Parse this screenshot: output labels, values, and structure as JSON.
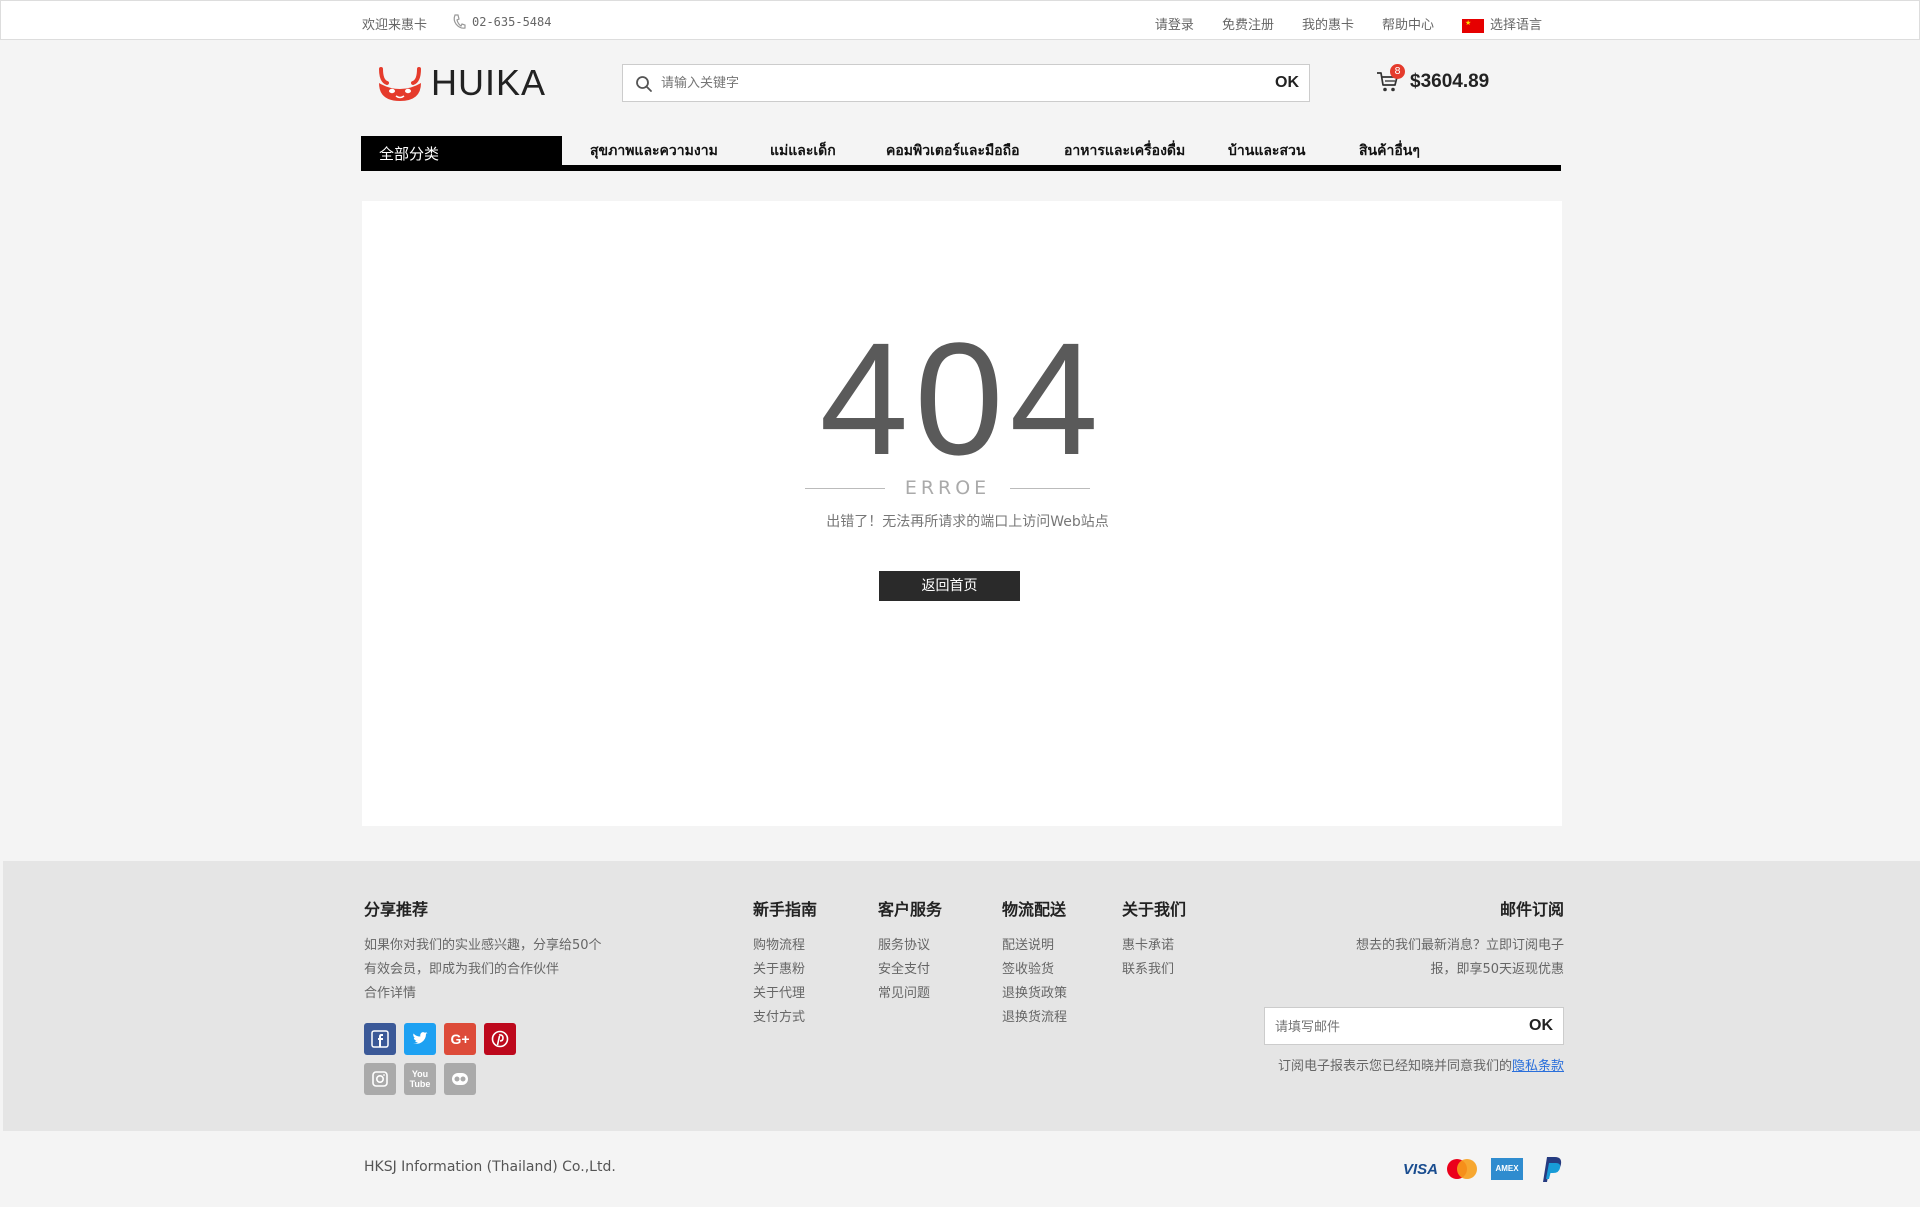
{
  "topbar": {
    "welcome": "欢迎来惠卡",
    "phone": "02-635-5484",
    "login": "请登录",
    "register": "免费注册",
    "my_account": "我的惠卡",
    "help": "帮助中心",
    "language": "选择语言"
  },
  "header": {
    "logo_text": "HUIKA",
    "search_placeholder": "请输入关键字",
    "search_button": "OK",
    "cart_count": "8",
    "cart_total": "$3604.89"
  },
  "nav": {
    "all_categories": "全部分类",
    "items": [
      "สุขภาพและความงาม",
      "แม่และเด็ก",
      "คอมพิวเตอร์และมือถือ",
      "อาหารและเครื่องดื่ม",
      "บ้านและสวน",
      "สินค้าอื่นๆ"
    ]
  },
  "error": {
    "code": "404",
    "label": "ERROE",
    "message": "出错了！无法再所请求的端口上访问Web站点",
    "back_button": "返回首页"
  },
  "footer": {
    "share": {
      "title": "分享推荐",
      "line1": "如果你对我们的实业感兴趣，分享给50个",
      "line2": "有效会员，即成为我们的合作伙伴",
      "line3": "合作详情"
    },
    "columns": [
      {
        "title": "新手指南",
        "links": [
          "购物流程",
          "关于惠粉",
          "关于代理",
          "支付方式"
        ]
      },
      {
        "title": "客户服务",
        "links": [
          "服务协议",
          "安全支付",
          "常见问题"
        ]
      },
      {
        "title": "物流配送",
        "links": [
          "配送说明",
          "签收验货",
          "退换货政策",
          "退换货流程"
        ]
      },
      {
        "title": "关于我们",
        "links": [
          "惠卡承诺",
          "联系我们"
        ]
      }
    ],
    "subscribe": {
      "title": "邮件订阅",
      "line1": "想去的我们最新消息？立即订阅电子",
      "line2": "报，即享50天返现优惠",
      "placeholder": "请填写邮件",
      "button": "OK",
      "note": "订阅电子报表示您已经知晓并同意我们的",
      "privacy": "隐私条款"
    },
    "social_icons": [
      "facebook-icon",
      "twitter-icon",
      "google-plus-icon",
      "pinterest-icon",
      "instagram-icon",
      "youtube-icon",
      "flickr-icon"
    ],
    "social_colors": {
      "facebook": "#3b5998",
      "twitter": "#1da1f2",
      "google_plus": "#dd4b39",
      "pinterest": "#bd081c",
      "muted": "#aaaaaa"
    }
  },
  "bottom": {
    "company": "HKSJ Information (Thailand) Co.,Ltd.",
    "payments": [
      "visa-icon",
      "mastercard-icon",
      "amex-icon",
      "paypal-icon"
    ],
    "visa_label": "VISA",
    "amex_label": "AMEX"
  }
}
